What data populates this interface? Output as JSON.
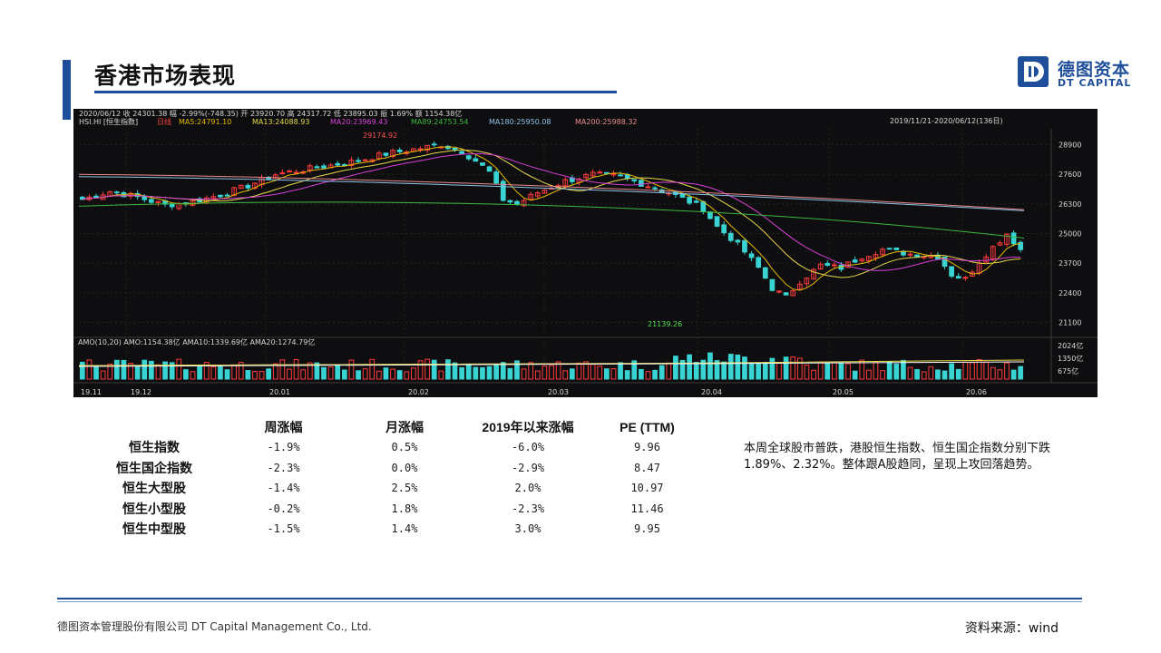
{
  "header": {
    "title": "香港市场表现",
    "logo_cn": "德图资本",
    "logo_en": "DT CAPITAL"
  },
  "chart_data": {
    "type": "candlestick",
    "info_bar": "2020/06/12  收 24301.38  幅 -2.99%(-748.35)  开 23920.70  高 24317.72  低 23895.03  振 1.69%  额 1154.38亿",
    "indicator_line": {
      "symbol": "HSI.HI [恒生指数]",
      "period": "日线",
      "ma": [
        {
          "label": "MA5:24791.10",
          "color": "#e6b800"
        },
        {
          "label": "MA13:24088.93",
          "color": "#e8d84a"
        },
        {
          "label": "MA20:23969.43",
          "color": "#d63fd6"
        },
        {
          "label": "MA89:24753.54",
          "color": "#3cb83c"
        },
        {
          "label": "MA180:25950.08",
          "color": "#8fc3e8"
        },
        {
          "label": "MA200:25988.32",
          "color": "#e88a8a"
        }
      ]
    },
    "range_label": "2019/11/21-2020/06/12(136日)",
    "y_ticks": [
      28900,
      27600,
      26300,
      25000,
      23700,
      22400,
      21100
    ],
    "y_range": [
      20600,
      29600
    ],
    "annotations": {
      "high": "29174.92",
      "low": "21139.26"
    },
    "volume": {
      "label": "AMO(10,20)  AMO:1154.38亿  AMA10:1339.69亿  AMA20:1274.79亿",
      "ticks": [
        "2024亿",
        "1350亿",
        "675亿"
      ]
    },
    "x_labels": [
      "19.11",
      "19.12",
      "20.01",
      "20.02",
      "20.03",
      "20.04",
      "20.05",
      "20.06"
    ],
    "colors": {
      "up": "#ff3b3b",
      "down": "#39d3d3",
      "background": "#0e0e10"
    }
  },
  "table": {
    "headers": [
      "",
      "周涨幅",
      "月涨幅",
      "2019年以来涨幅",
      "PE (TTM)"
    ],
    "rows": [
      {
        "name": "恒生指数",
        "week": "-1.9%",
        "month": "0.5%",
        "ytd": "-6.0%",
        "pe": "9.96"
      },
      {
        "name": "恒生国企指数",
        "week": "-2.3%",
        "month": "0.0%",
        "ytd": "-2.9%",
        "pe": "8.47"
      },
      {
        "name": "恒生大型股",
        "week": "-1.4%",
        "month": "2.5%",
        "ytd": "2.0%",
        "pe": "10.97"
      },
      {
        "name": "恒生小型股",
        "week": "-0.2%",
        "month": "1.8%",
        "ytd": "-2.3%",
        "pe": "11.46"
      },
      {
        "name": "恒生中型股",
        "week": "-1.5%",
        "month": "1.4%",
        "ytd": "3.0%",
        "pe": "9.95"
      }
    ]
  },
  "commentary": "本周全球股市普跌，港股恒生指数、恒生国企指数分别下跌1.89%、2.32%。整体跟A股趋同，呈现上攻回落趋势。",
  "footer": {
    "company": "德图资本管理股份有限公司  DT Capital Management Co., Ltd.",
    "source": "资料来源：wind"
  },
  "brand_color": "#1f4e9a"
}
